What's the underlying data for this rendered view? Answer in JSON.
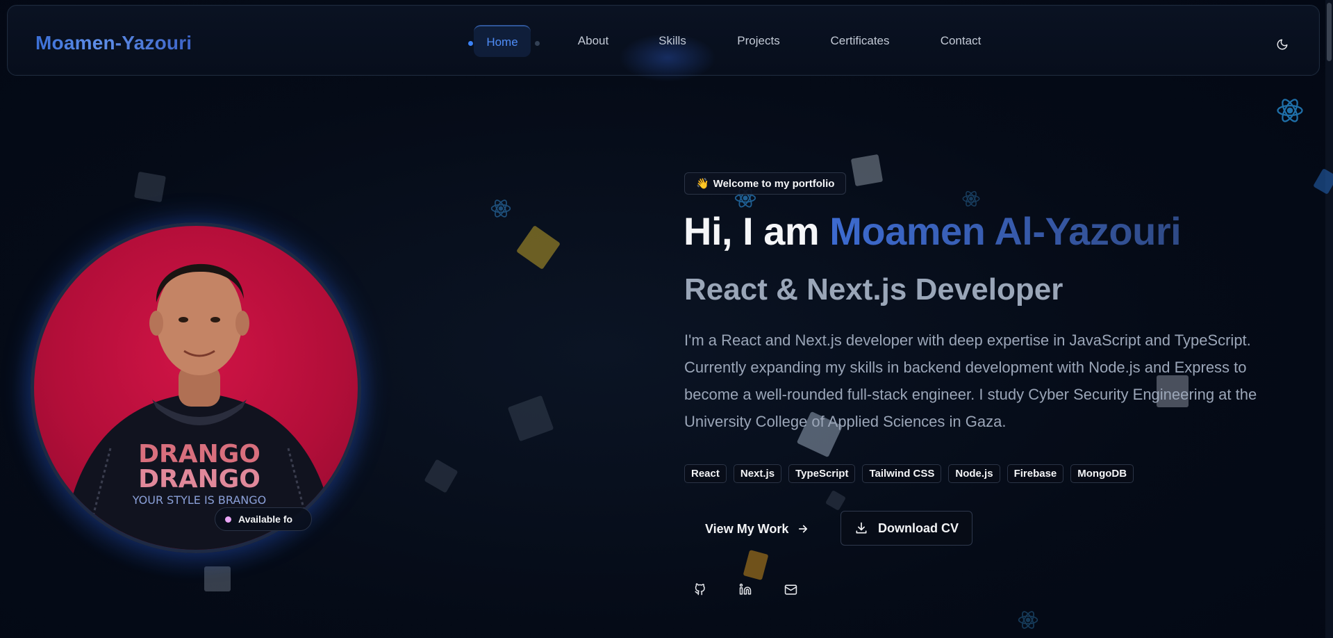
{
  "header": {
    "logo": "Moamen-Yazouri",
    "nav": [
      {
        "label": "Home",
        "active": true
      },
      {
        "label": "About",
        "active": false
      },
      {
        "label": "Skills",
        "active": false
      },
      {
        "label": "Projects",
        "active": false
      },
      {
        "label": "Certificates",
        "active": false
      },
      {
        "label": "Contact",
        "active": false
      }
    ],
    "theme_toggle_icon": "moon-icon"
  },
  "profile": {
    "status_label": "Available fo",
    "shirt_text": [
      "DRANGO",
      "DRANGO",
      "YOUR STYLE IS BRANGO"
    ]
  },
  "hero": {
    "welcome_emoji": "👋",
    "welcome": "Welcome to my portfolio",
    "greeting": "Hi, I am ",
    "name": "Moamen Al-Yazouri",
    "role": "React & Next.js Developer",
    "description": "I'm a React and Next.js developer with deep expertise in JavaScript and TypeScript. Currently expanding my skills in backend development with Node.js and Express to become a well-rounded full-stack engineer. I study Cyber Security Engineering at the University College of Applied Sciences in Gaza.",
    "tags": [
      "React",
      "Next.js",
      "TypeScript",
      "Tailwind CSS",
      "Node.js",
      "Firebase",
      "MongoDB"
    ],
    "view_work": "View My Work",
    "download_cv": "Download CV",
    "social_icons": [
      "github-icon",
      "linkedin-icon",
      "mail-icon"
    ]
  },
  "colors": {
    "background": "#050b17",
    "accent": "#3b82f6",
    "avatar_bg": "#c8103f"
  }
}
